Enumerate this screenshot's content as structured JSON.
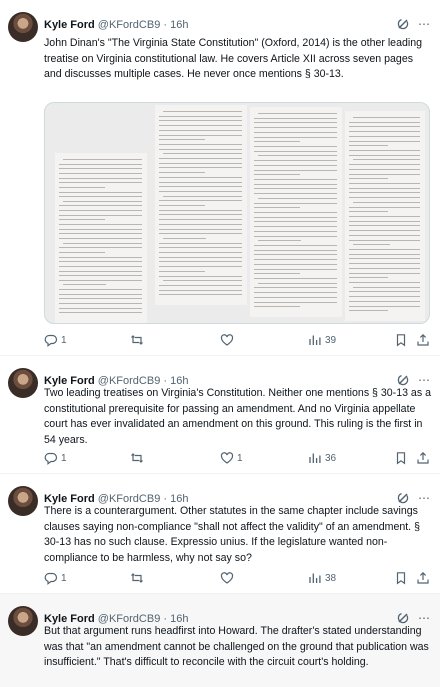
{
  "tweets": [
    {
      "author": {
        "name": "Kyle Ford",
        "handle": "@KFordCB9",
        "time": "16h"
      },
      "text": "John Dinan's \"The Virginia State Constitution\" (Oxford, 2014) is the other leading treatise on Virginia constitutional law. He covers Article XII across seven pages and discusses multiple cases. He never once mentions § 30-13.",
      "has_media": true,
      "stats": {
        "replies": "1",
        "reposts": "",
        "likes": "",
        "views": "39"
      }
    },
    {
      "author": {
        "name": "Kyle Ford",
        "handle": "@KFordCB9",
        "time": "16h"
      },
      "text": "Two leading treatises on Virginia's Constitution. Neither one mentions § 30-13 as a constitutional prerequisite for passing an amendment. And no Virginia appellate court has ever invalidated an amendment on this ground. This ruling is the first in 54 years.",
      "has_media": false,
      "stats": {
        "replies": "1",
        "reposts": "",
        "likes": "1",
        "views": "36"
      }
    },
    {
      "author": {
        "name": "Kyle Ford",
        "handle": "@KFordCB9",
        "time": "16h"
      },
      "text": "There is a counterargument. Other statutes in the same chapter include savings clauses saying non-compliance \"shall not affect the validity\" of an amendment. § 30-13 has no such clause. Expressio unius. If the legislature wanted non-compliance to be harmless, why not say so?",
      "has_media": false,
      "stats": {
        "replies": "1",
        "reposts": "",
        "likes": "",
        "views": "38"
      }
    },
    {
      "author": {
        "name": "Kyle Ford",
        "handle": "@KFordCB9",
        "time": "16h"
      },
      "text": "But that argument runs headfirst into Howard. The drafter's stated understanding was that \"an amendment cannot be challenged on the ground that publication was insufficient.\" That's difficult to reconcile with the circuit court's holding.",
      "has_media": false,
      "stats": null
    }
  ],
  "icons": {
    "reply": "reply-icon",
    "repost": "repost-icon",
    "like": "like-icon",
    "views": "views-icon",
    "bookmark": "bookmark-icon",
    "share": "share-icon",
    "grok": "grok-icon",
    "more": "more-icon"
  },
  "media": {
    "alt": "photo of scanned book pages"
  }
}
